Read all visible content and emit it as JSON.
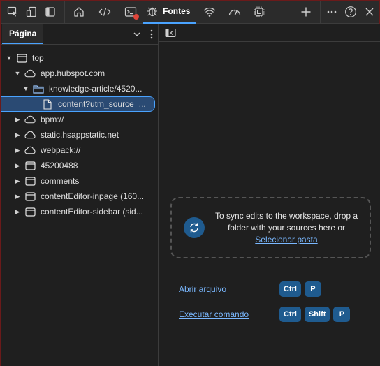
{
  "toolbar": {
    "items": [
      {
        "name": "inspect-element-icon"
      },
      {
        "name": "device-emulation-icon"
      },
      {
        "name": "toggle-sidebar-icon"
      },
      {
        "name": "home-icon"
      },
      {
        "name": "elements-code-icon"
      },
      {
        "name": "console-icon"
      },
      {
        "name": "sources-bug-icon"
      }
    ],
    "active_tab_label": "Fontes",
    "right_icons": [
      "network-wifi-icon",
      "performance-icon",
      "memory-chip-icon",
      "add-tool-icon",
      "more-icon",
      "help-icon",
      "close-icon"
    ]
  },
  "left_panel": {
    "tab_label": "Página",
    "tree": [
      {
        "label": "top",
        "level": 0,
        "expanded": true,
        "icon": "frame-icon"
      },
      {
        "label": "app.hubspot.com",
        "level": 1,
        "expanded": true,
        "icon": "cloud-icon"
      },
      {
        "label": "knowledge-article/4520...",
        "level": 2,
        "expanded": true,
        "icon": "folder-icon"
      },
      {
        "label": "content?utm_source=...",
        "level": 3,
        "expanded": null,
        "icon": "file-icon",
        "selected": true
      },
      {
        "label": "bpm://",
        "level": 1,
        "expanded": false,
        "icon": "cloud-icon"
      },
      {
        "label": "static.hsappstatic.net",
        "level": 1,
        "expanded": false,
        "icon": "cloud-icon"
      },
      {
        "label": "webpack://",
        "level": 1,
        "expanded": false,
        "icon": "cloud-icon"
      },
      {
        "label": "45200488",
        "level": 1,
        "expanded": false,
        "icon": "frame-icon"
      },
      {
        "label": "comments",
        "level": 1,
        "expanded": false,
        "icon": "frame-icon"
      },
      {
        "label": "contentEditor-inpage (160...",
        "level": 1,
        "expanded": false,
        "icon": "frame-icon"
      },
      {
        "label": "contentEditor-sidebar (sid...",
        "level": 1,
        "expanded": false,
        "icon": "frame-icon"
      }
    ]
  },
  "right_panel": {
    "dropzone": {
      "text": "To sync edits to the workspace, drop a folder with your sources here or",
      "link": "Selecionar pasta"
    },
    "shortcuts": [
      {
        "label": "Abrir arquivo",
        "keys": [
          "Ctrl",
          "P"
        ]
      },
      {
        "label": "Executar comando",
        "keys": [
          "Ctrl",
          "Shift",
          "P"
        ]
      }
    ]
  },
  "colors": {
    "accent": "#4aa3ff",
    "key_bg": "#1f5b8f",
    "selected_bg": "#2a4a73",
    "link": "#7ab8ff",
    "badge": "#e0453a"
  }
}
